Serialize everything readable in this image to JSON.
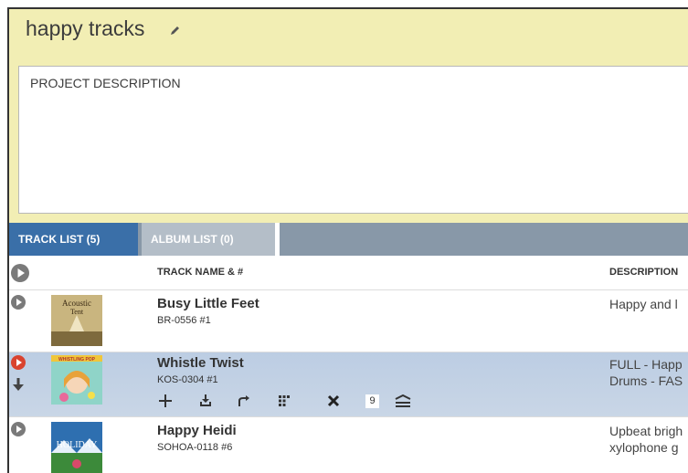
{
  "project": {
    "title": "happy tracks",
    "description_label": "PROJECT DESCRIPTION"
  },
  "tabs": {
    "track_list": "TRACK LIST (5)",
    "album_list": "ALBUM LIST (0)"
  },
  "columns": {
    "track_name": "TRACK NAME & #",
    "description": "DESCRIPTION"
  },
  "tracks": [
    {
      "name": "Busy Little Feet",
      "code": "BR-0556 #1",
      "description_line1": "Happy and l",
      "description_line2": "",
      "cover_text": "Acoustic Tent"
    },
    {
      "name": "Whistle Twist",
      "code": "KOS-0304 #1",
      "description_line1": "FULL - Happ",
      "description_line2": "Drums - FAS",
      "cover_text": "WHISTLING POP",
      "action_count": "9"
    },
    {
      "name": "Happy Heidi",
      "code": "SOHOA-0118 #6",
      "description_line1": "Upbeat brigh",
      "description_line2": "xylophone g",
      "cover_text": "HOLIDAY"
    }
  ],
  "icons": {
    "play": "play-circle-icon",
    "download": "download-icon",
    "add": "plus-icon",
    "share": "share-icon",
    "versions": "grid-icon",
    "remove": "close-icon",
    "lyrics": "lines-icon"
  },
  "colors": {
    "header_bg": "#f2eeb4",
    "tab_active": "#3a6fa8",
    "tab_bar": "#8898a8",
    "selected_row": "#c2d1e5",
    "play_red": "#d9432f"
  }
}
